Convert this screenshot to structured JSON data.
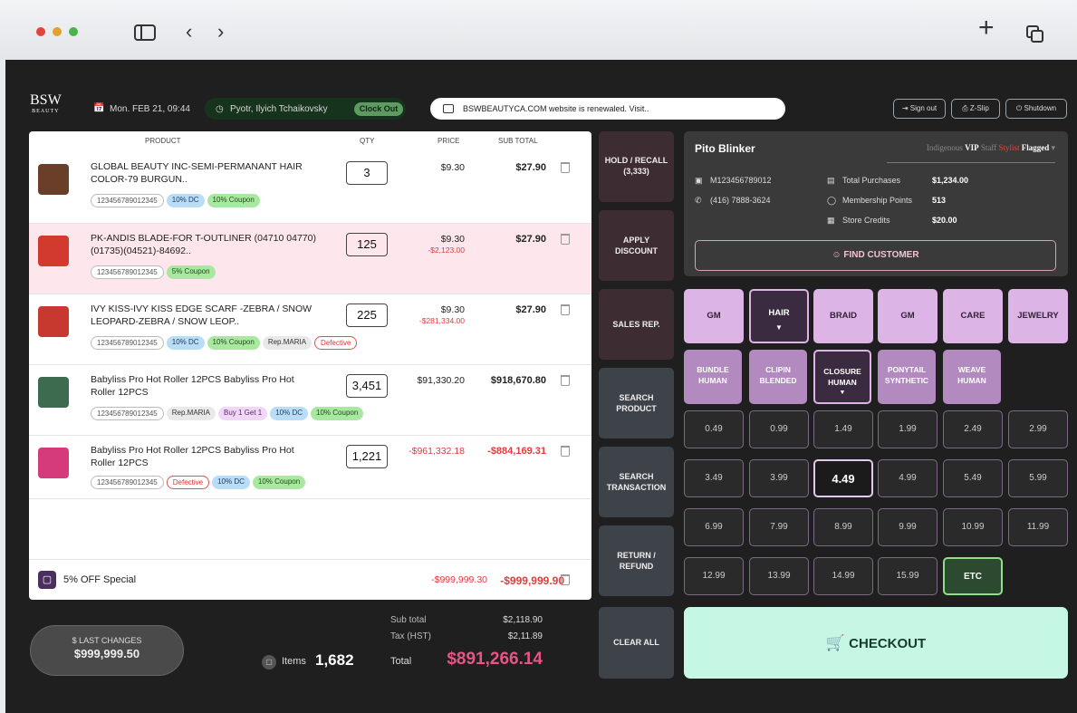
{
  "header": {
    "date": "Mon. FEB 21, 09:44",
    "user": "Pyotr, Ilyich Tchaikovsky",
    "clock_out": "Clock Out",
    "notice": "BSWBEAUTYCA.COM website is renewaled. Visit..",
    "sign_out": "Sign out",
    "z_slip": "Z-Slip",
    "shutdown": "Shutdown",
    "logo_top": "BSW",
    "logo_bottom": "BEAUTY"
  },
  "cart": {
    "headers": {
      "product": "PRODUCT",
      "qty": "QTY",
      "price": "PRICE",
      "subtotal": "SUB TOTAL"
    },
    "items": [
      {
        "name": "GLOBAL BEAUTY INC-SEMI-PERMANANT HAIR COLOR-79 BURGUN..",
        "qty": "3",
        "price": "$9.30",
        "price2": "",
        "subtotal": "$27.90",
        "code": "123456789012345",
        "tags": [
          "10% DC",
          "10% Coupon"
        ]
      },
      {
        "name": "PK-ANDIS BLADE-FOR T-OUTLINER (04710 04770) (01735)(04521)-84692..",
        "qty": "125",
        "price": "$9.30",
        "price2": "-$2,123.00",
        "subtotal": "$27.90",
        "code": "123456789012345",
        "tags": [
          "5% Coupon"
        ]
      },
      {
        "name": "IVY KISS-IVY KISS EDGE SCARF -ZEBRA / SNOW LEOPARD-ZEBRA / SNOW LEOP..",
        "qty": "225",
        "price": "$9.30",
        "price2": "-$281,334.00",
        "subtotal": "$27.90",
        "code": "123456789012345",
        "tags": [
          "10% DC",
          "10% Coupon",
          "Rep.MARIA",
          "Defective"
        ]
      },
      {
        "name": "Babyliss Pro Hot Roller 12PCS Babyliss Pro Hot Roller 12PCS",
        "qty": "3,451",
        "price": "$91,330.20",
        "price2": "",
        "subtotal": "$918,670.80",
        "code": "123456789012345",
        "tags": [
          "Rep.MARIA",
          "Buy 1 Get 1",
          "10% DC",
          "10% Coupon"
        ]
      },
      {
        "name": "Babyliss Pro Hot Roller 12PCS Babyliss Pro Hot Roller 12PCS",
        "qty": "1,221",
        "price": "-$961,332.18",
        "price2": "",
        "subtotal": "-$884,169.31",
        "code": "123456789012345",
        "tags": [
          "Defective",
          "10% DC",
          "10% Coupon"
        ]
      }
    ],
    "special": {
      "label": "5% OFF Special",
      "price": "-$999,999.30",
      "subtotal": "-$999,999.90"
    }
  },
  "totals": {
    "last_changes_label": "$ LAST CHANGES",
    "last_changes": "$999,999.50",
    "items_label": "Items",
    "items": "1,682",
    "subtotal_label": "Sub total",
    "subtotal": "$2,118.90",
    "tax_label": "Tax (HST)",
    "tax": "$2,11.89",
    "total_label": "Total",
    "total": "$891,266.14"
  },
  "actions": {
    "hold": "HOLD / RECALL",
    "hold_count": "(3,333)",
    "discount1": "APPLY",
    "discount2": "DISCOUNT",
    "sales": "SALES REP.",
    "search_prod1": "SEARCH",
    "search_prod2": "PRODUCT",
    "search_tx1": "SEARCH",
    "search_tx2": "TRANSACTION",
    "return1": "RETURN /",
    "return2": "REFUND",
    "clear": "CLEAR ALL"
  },
  "customer": {
    "name": "Pito Blinker",
    "flags": [
      "Indigenous",
      "VIP",
      "Staff",
      "Stylist",
      "Flagged"
    ],
    "id": "M123456789012",
    "phone": "(416) 7888-3624",
    "purchases_label": "Total Purchases",
    "purchases": "$1,234.00",
    "points_label": "Membership Points",
    "points": "513",
    "credits_label": "Store Credits",
    "credits": "$20.00",
    "find": "FIND CUSTOMER"
  },
  "categories": [
    "GM",
    "HAIR",
    "BRAID",
    "GM",
    "CARE",
    "JEWELRY"
  ],
  "subcategories": [
    [
      "BUNDLE",
      "HUMAN"
    ],
    [
      "CLIPIN",
      "BLENDED"
    ],
    [
      "CLOSURE",
      "HUMAN"
    ],
    [
      "PONYTAIL",
      "SYNTHETIC"
    ],
    [
      "WEAVE",
      "HUMAN"
    ]
  ],
  "prices": [
    "0.49",
    "0.99",
    "1.49",
    "1.99",
    "2.49",
    "2.99",
    "3.49",
    "3.99",
    "4.49",
    "4.99",
    "5.49",
    "5.99",
    "6.99",
    "7.99",
    "8.99",
    "9.99",
    "10.99",
    "11.99",
    "12.99",
    "13.99",
    "14.99",
    "15.99",
    "ETC"
  ],
  "checkout": "CHECKOUT",
  "colors": {
    "accent": "#dcb4e6",
    "checkout": "#c6f7e4",
    "negative": "#e23b3b",
    "highlight_row": "#fde6ec"
  }
}
